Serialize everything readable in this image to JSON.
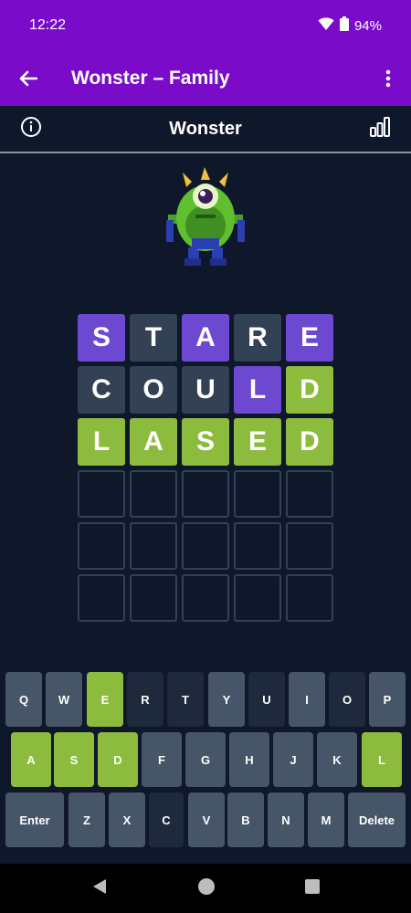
{
  "status": {
    "time": "12:22",
    "battery": "94%"
  },
  "appbar": {
    "title": "Wonster – Family"
  },
  "game": {
    "title": "Wonster"
  },
  "board": [
    [
      {
        "l": "S",
        "s": "present"
      },
      {
        "l": "T",
        "s": "absent"
      },
      {
        "l": "A",
        "s": "present"
      },
      {
        "l": "R",
        "s": "absent"
      },
      {
        "l": "E",
        "s": "present"
      }
    ],
    [
      {
        "l": "C",
        "s": "absent"
      },
      {
        "l": "O",
        "s": "absent"
      },
      {
        "l": "U",
        "s": "absent"
      },
      {
        "l": "L",
        "s": "present"
      },
      {
        "l": "D",
        "s": "correct"
      }
    ],
    [
      {
        "l": "L",
        "s": "correct"
      },
      {
        "l": "A",
        "s": "correct"
      },
      {
        "l": "S",
        "s": "correct"
      },
      {
        "l": "E",
        "s": "correct"
      },
      {
        "l": "D",
        "s": "correct"
      }
    ],
    [
      {
        "l": "",
        "s": "empty"
      },
      {
        "l": "",
        "s": "empty"
      },
      {
        "l": "",
        "s": "empty"
      },
      {
        "l": "",
        "s": "empty"
      },
      {
        "l": "",
        "s": "empty"
      }
    ],
    [
      {
        "l": "",
        "s": "empty"
      },
      {
        "l": "",
        "s": "empty"
      },
      {
        "l": "",
        "s": "empty"
      },
      {
        "l": "",
        "s": "empty"
      },
      {
        "l": "",
        "s": "empty"
      }
    ],
    [
      {
        "l": "",
        "s": "empty"
      },
      {
        "l": "",
        "s": "empty"
      },
      {
        "l": "",
        "s": "empty"
      },
      {
        "l": "",
        "s": "empty"
      },
      {
        "l": "",
        "s": "empty"
      }
    ]
  ],
  "keyboard": {
    "rows": [
      [
        {
          "label": "Q",
          "state": "default"
        },
        {
          "label": "W",
          "state": "default"
        },
        {
          "label": "E",
          "state": "correct"
        },
        {
          "label": "R",
          "state": "absent"
        },
        {
          "label": "T",
          "state": "absent"
        },
        {
          "label": "Y",
          "state": "default"
        },
        {
          "label": "U",
          "state": "absent"
        },
        {
          "label": "I",
          "state": "default"
        },
        {
          "label": "O",
          "state": "absent"
        },
        {
          "label": "P",
          "state": "default"
        }
      ],
      [
        {
          "label": "A",
          "state": "correct"
        },
        {
          "label": "S",
          "state": "correct"
        },
        {
          "label": "D",
          "state": "correct"
        },
        {
          "label": "F",
          "state": "default"
        },
        {
          "label": "G",
          "state": "default"
        },
        {
          "label": "H",
          "state": "default"
        },
        {
          "label": "J",
          "state": "default"
        },
        {
          "label": "K",
          "state": "default"
        },
        {
          "label": "L",
          "state": "correct"
        }
      ],
      [
        {
          "label": "Enter",
          "state": "default"
        },
        {
          "label": "Z",
          "state": "default"
        },
        {
          "label": "X",
          "state": "default"
        },
        {
          "label": "C",
          "state": "absent"
        },
        {
          "label": "V",
          "state": "default"
        },
        {
          "label": "B",
          "state": "default"
        },
        {
          "label": "N",
          "state": "default"
        },
        {
          "label": "M",
          "state": "default"
        },
        {
          "label": "Delete",
          "state": "default"
        }
      ]
    ]
  },
  "colors": {
    "accent": "#7a0cc9",
    "present": "#6d49d2",
    "correct": "#8dbb3d",
    "absent": "#334155",
    "key": "#475569",
    "background": "#0f172a"
  },
  "icons": [
    "back-arrow-icon",
    "more-vert-icon",
    "info-icon",
    "stats-icon",
    "wifi-icon",
    "battery-icon",
    "nav-back-icon",
    "nav-home-icon",
    "nav-recents-icon"
  ]
}
